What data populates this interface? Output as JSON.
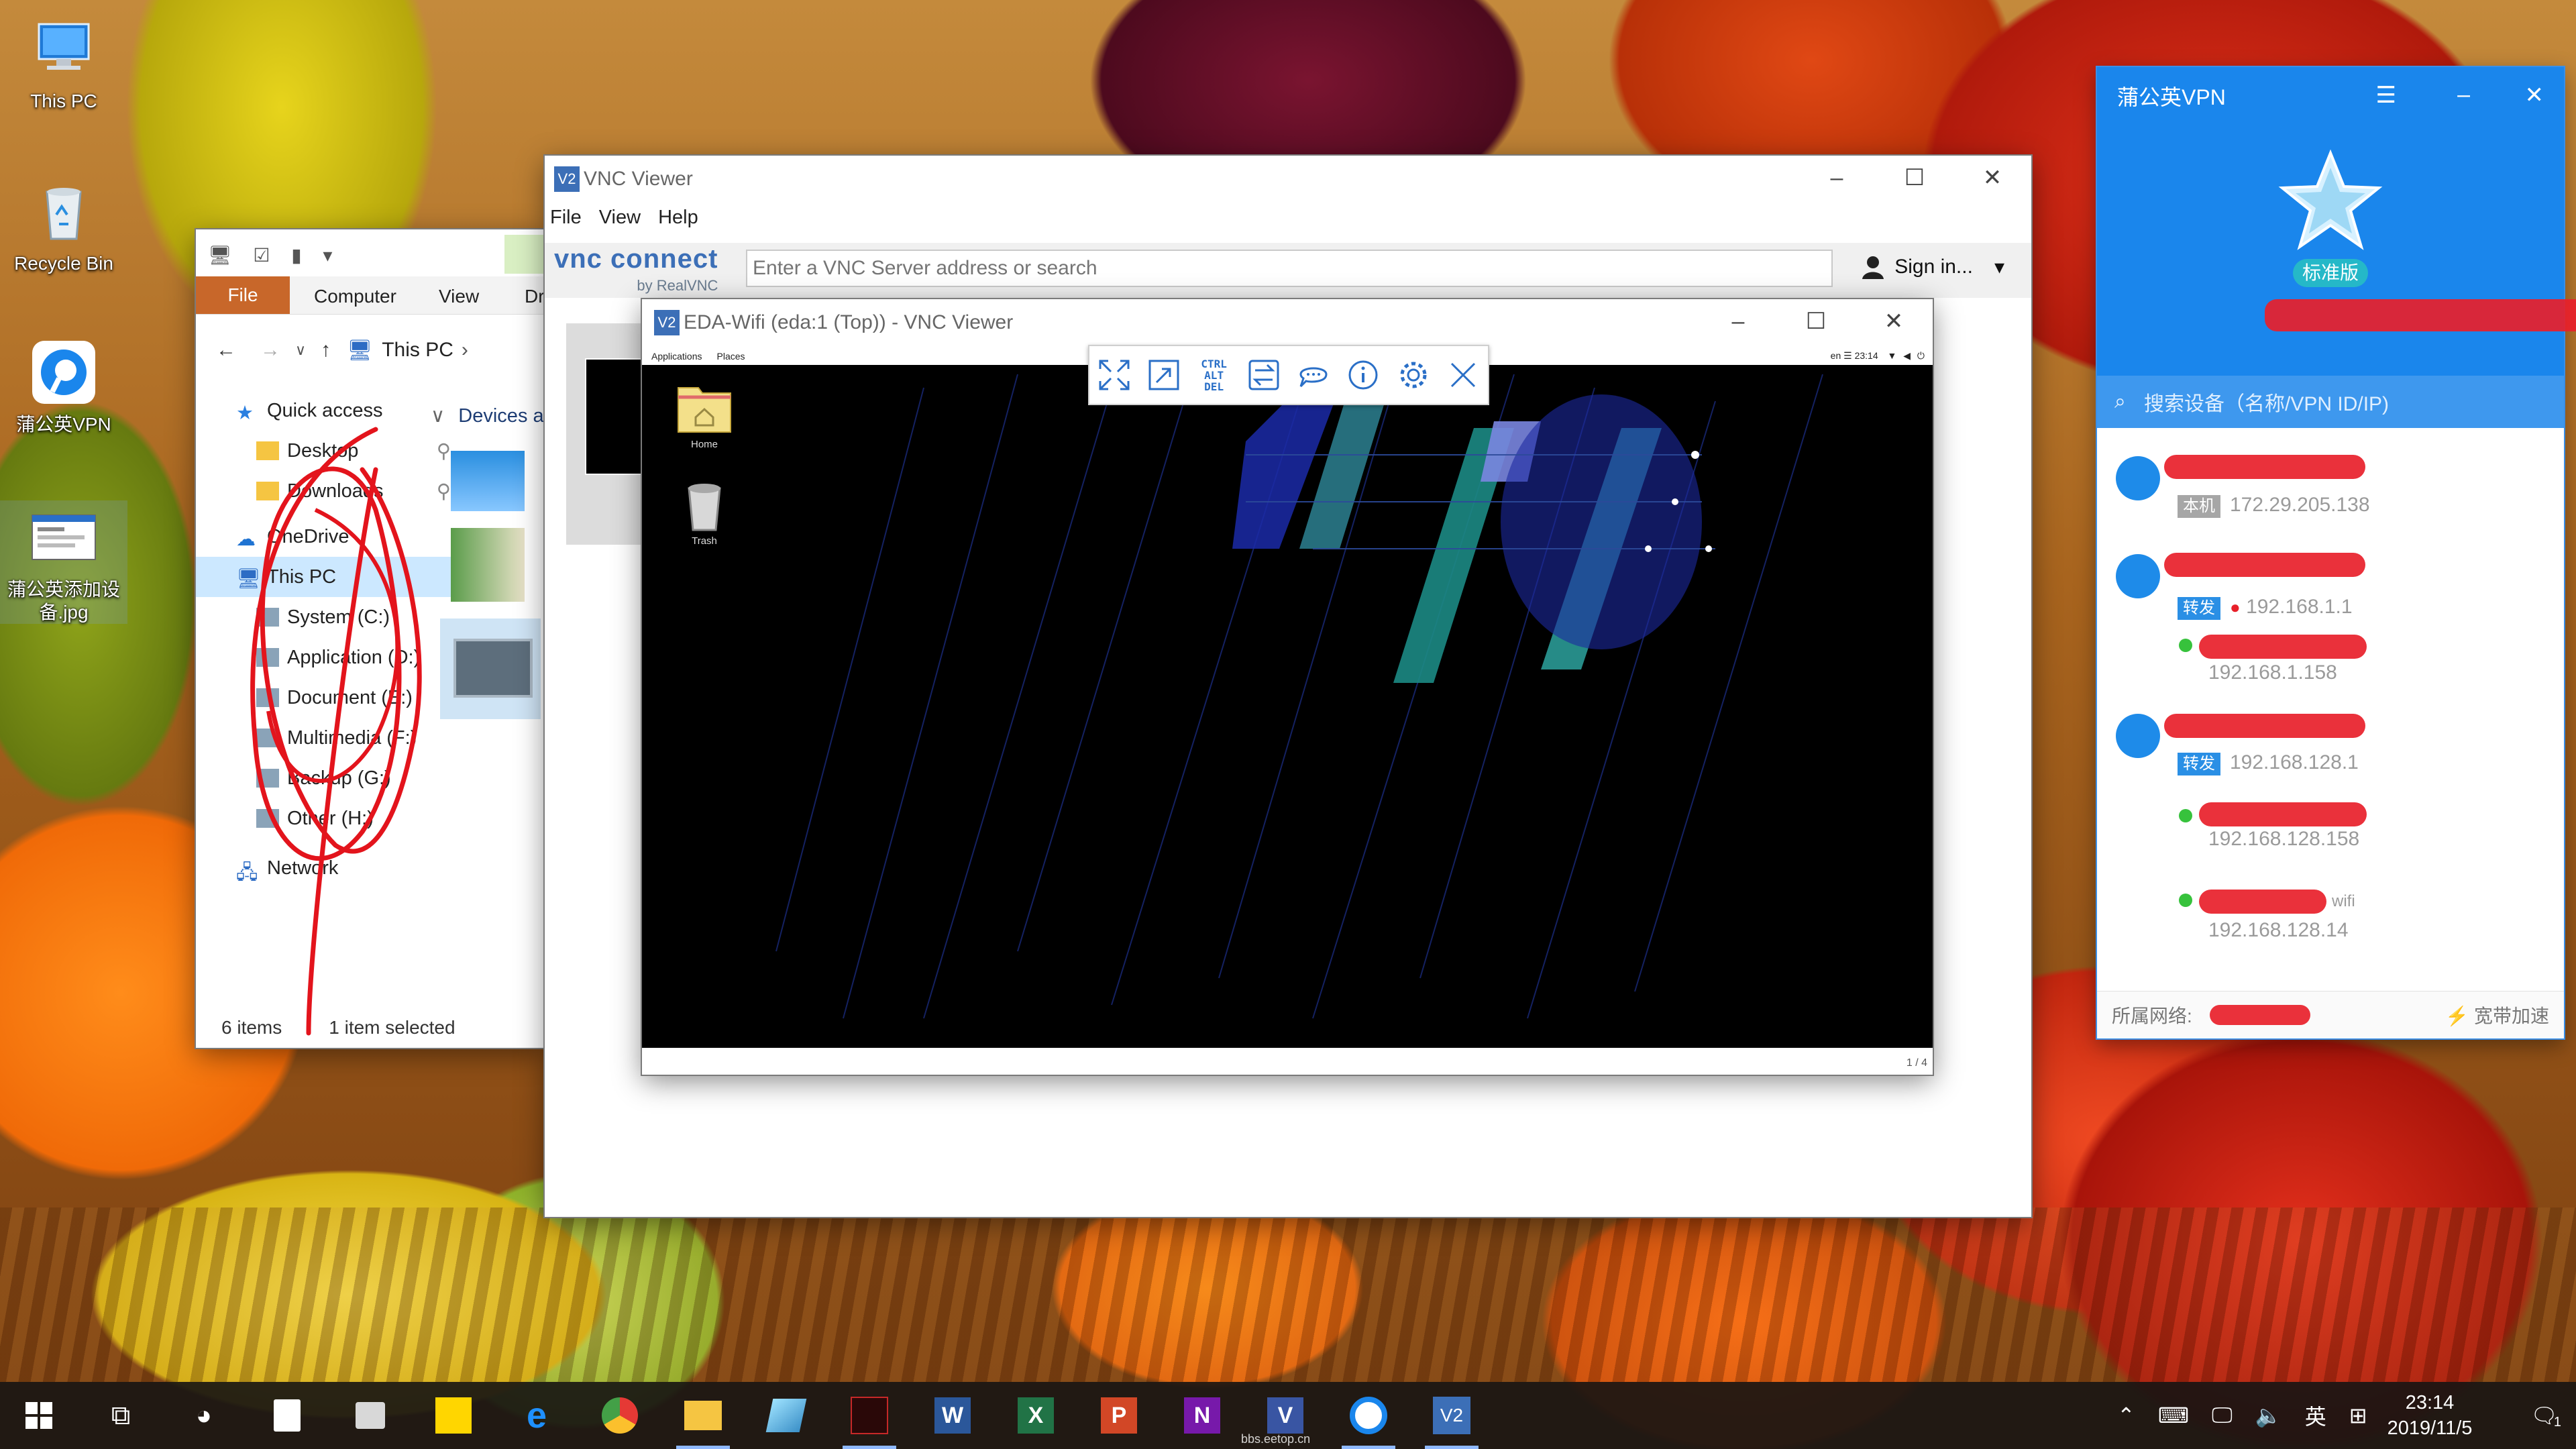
{
  "desktop": {
    "icons": [
      {
        "label": "This PC"
      },
      {
        "label": "Recycle Bin"
      },
      {
        "label": "蒲公英VPN"
      },
      {
        "label": "蒲公英添加设备.jpg"
      }
    ]
  },
  "explorer": {
    "ribbon_tabs": [
      "File",
      "Computer",
      "View",
      "Dr"
    ],
    "address": "This PC",
    "nav": {
      "quick_access": "Quick access",
      "desktop": "Desktop",
      "downloads": "Downloads",
      "onedrive": "OneDrive",
      "this_pc": "This PC",
      "drives": [
        "System (C:)",
        "Application (D:)",
        "Document (E:)",
        "Multimedia (F:)",
        "Backup (G:)",
        "Other (H:)"
      ],
      "network": "Network"
    },
    "section_header": "Devices a",
    "status": {
      "items": "6 items",
      "selected": "1 item selected"
    }
  },
  "vnc_viewer": {
    "title": "VNC Viewer",
    "menu": [
      "File",
      "View",
      "Help"
    ],
    "logo": "vnc connect",
    "logo_sub": "by RealVNC",
    "search_placeholder": "Enter a VNC Server address or search",
    "sign_in": "Sign in..."
  },
  "session": {
    "title": "EDA-Wifi (eda:1 (Top)) - VNC Viewer",
    "gnome_menu": [
      "Applications",
      "Places"
    ],
    "gnome_status": "en  ☰ 23:14",
    "desktop_icons": [
      {
        "label": "Home"
      },
      {
        "label": "Trash"
      }
    ],
    "page_indicator": "1 / 4",
    "toolbar": [
      "fullscreen-icon",
      "scale-icon",
      "ctrl-alt-del-icon",
      "transfer-icon",
      "chat-icon",
      "info-icon",
      "settings-icon",
      "close-icon"
    ],
    "cad_text": "CTRL ALT DEL"
  },
  "vpn": {
    "title": "蒲公英VPN",
    "edition": "标准版",
    "search_placeholder": "搜索设备（名称/VPN ID/IP)",
    "peers": [
      {
        "tag": "本机",
        "ip": "172.29.205.138"
      },
      {
        "tag": "转发",
        "ip": "192.168.1.1"
      },
      {
        "ip": "192.168.1.158"
      },
      {
        "tag": "转发",
        "ip": "192.168.128.1"
      },
      {
        "ip": "192.168.128.158"
      },
      {
        "ip": "192.168.128.14",
        "name_fragment": "wifi"
      }
    ],
    "footer_left": "所属网络:",
    "footer_right": "宽带加速",
    "colors": {
      "header": "#1a86ec",
      "online": "#37c23c",
      "redaction": "#e8202a"
    }
  },
  "taskbar": {
    "ime": "英",
    "time": "23:14",
    "date": "2019/11/5",
    "notification_count": "1",
    "watermark": "bbs.eetop.cn"
  }
}
